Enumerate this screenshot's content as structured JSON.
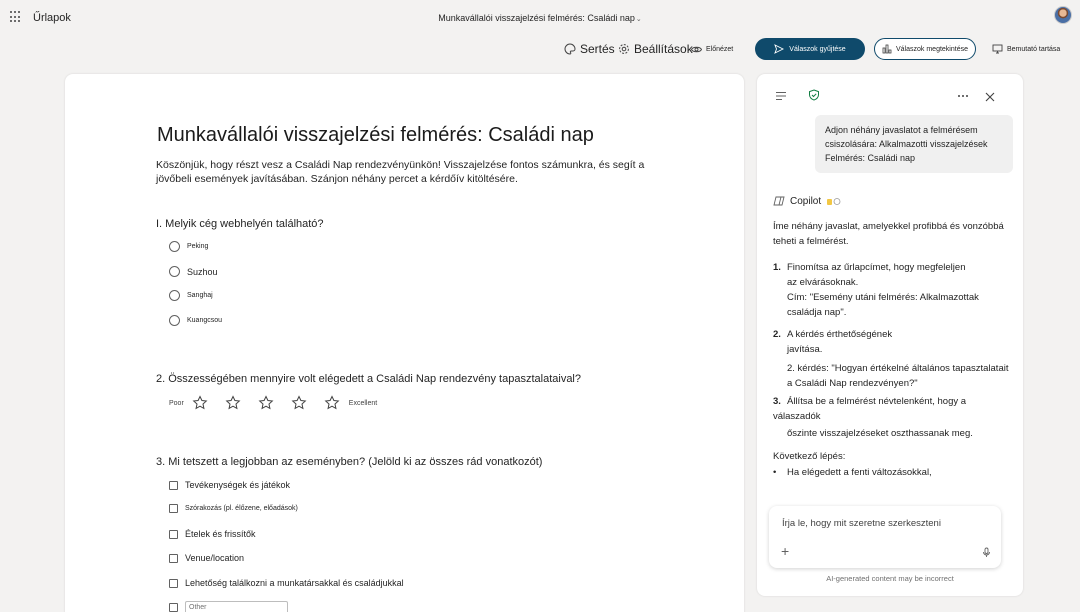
{
  "app": {
    "name": "Űrlapok",
    "doc_title": "Munkavállalói visszajelzési felmérés: Családi nap"
  },
  "toolbar": {
    "theme": "Sertés",
    "settings": "Beállítások",
    "preview": "Előnézet",
    "collect": "Válaszok gyűjtése",
    "view_responses": "Válaszok megtekintése",
    "present": "Bemutató tartása"
  },
  "form": {
    "title": "Munkavállalói visszajelzési felmérés: Családi nap",
    "description": "Köszönjük, hogy részt vesz a Családi Nap rendezvényünkön! Visszajelzése fontos számunkra, és segít a jövőbeli események javításában. Szánjon néhány percet a kérdőív kitöltésére.",
    "q1": {
      "text": "I. Melyik cég webhelyén található?",
      "options": [
        "Peking",
        "Suzhou",
        "Sanghaj",
        "Kuangcsou"
      ]
    },
    "q2": {
      "number": "2.",
      "text": "Összességében mennyire volt elégedett a Családi Nap rendezvény tapasztalataival?",
      "low": "Poor",
      "high": "Excellent",
      "stars": 5
    },
    "q3": {
      "number": "3.",
      "text": "Mi tetszett a legjobban az eseményben? (Jelöld ki az összes rád vonatkozót)",
      "options": [
        "Tevékenységek és játékok",
        "Szórakozás (pl. élőzene, előadások)",
        "Ételek és frissítők",
        "Venue/location",
        "Lehetőség találkozni a munkatársakkal és családjukkal"
      ],
      "other": "Other"
    }
  },
  "copilot": {
    "user_message": "Adjon néhány javaslatot a felmérésem csiszolására: Alkalmazotti visszajelzések Felmérés: Családi nap",
    "name": "Copilot",
    "intro": "Íme néhány javaslat, amelyekkel profibbá és vonzóbbá teheti a felmérést.",
    "items": [
      {
        "num": "1.",
        "line1": "Finomítsa az űrlapcímet, hogy megfeleljen",
        "line2": "az elvárásoknak.",
        "line3": "Cím: \"Esemény utáni felmérés: Alkalmazottak családja nap\"."
      },
      {
        "num": "2.",
        "line1": "A kérdés érthetőségének",
        "line2": "javítása.",
        "line3": "2. kérdés: \"Hogyan értékelné általános tapasztalatait a Családi Nap rendezvényen?\""
      },
      {
        "num": "3.",
        "line1": "Állítsa be a felmérést névtelenként, hogy a válaszadók",
        "line2": "őszinte visszajelzéseket oszthassanak meg.",
        "line3": ""
      }
    ],
    "next_step": "Következő lépés:",
    "bullet": "Ha elégedett a fenti változásokkal,",
    "input_placeholder": "Írja le, hogy mit szeretne szerkeszteni",
    "disclaimer": "AI-generated content may be incorrect"
  }
}
